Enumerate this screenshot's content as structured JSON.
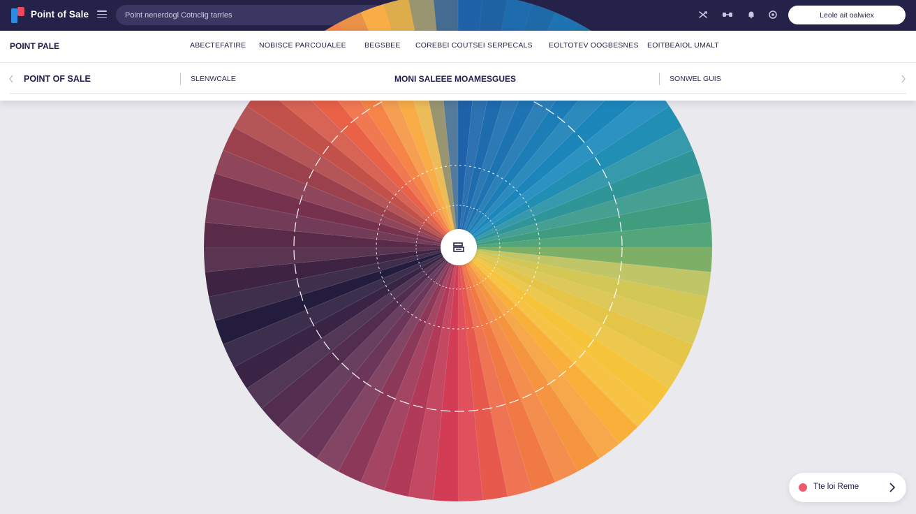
{
  "app": {
    "title": "Point of Sale"
  },
  "topbar": {
    "search_placeholder": "Point nenerdogl Cotnclig tarrles",
    "action_button_label": "Leole ait oalwiex",
    "icons": [
      "shuffle-icon",
      "link-icon",
      "bell-icon",
      "settings-icon"
    ]
  },
  "header": {
    "brand": "POINT PALE",
    "nav": [
      "ABECTEFATIRE",
      "NOBISCE PARCOUALEE",
      "BEGSBEE",
      "COREBEI COUTSEI SERPECALS",
      "EOLTOTEV OOGBESNES",
      "EOITBEAIOL UMALT"
    ],
    "sub": {
      "title": "POINT OF SALE",
      "left_item": "SLENWCALE",
      "center_title": "MONI SALEEE MOAMESGUES",
      "right_item": "SONWEL GUIS"
    }
  },
  "wheel": {
    "center_icon": "register-icon"
  },
  "chip": {
    "label": "Tte loi Reme",
    "dot_color": "#ee5a6c"
  },
  "colors": {
    "topbar_bg": "#25224a",
    "page_bg": "#e9e9ee",
    "accent_red": "#ee5a6c",
    "logo_blue": "#2f8be0"
  }
}
